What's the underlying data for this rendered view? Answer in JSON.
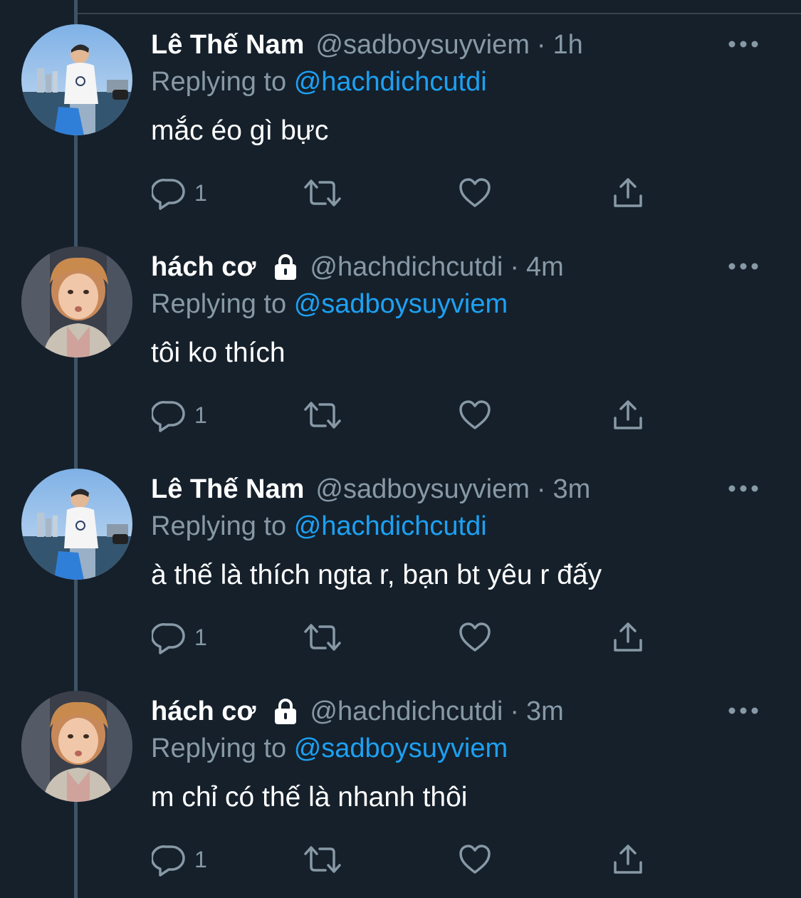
{
  "colors": {
    "background": "#15202b",
    "primary_text": "#ffffff",
    "secondary_text": "#8899a6",
    "link": "#1da1f2",
    "thread_line": "#3d5466"
  },
  "tweets": [
    {
      "display_name": "Lê Thế Nam",
      "handle": "@sadboysuyviem",
      "separator": "·",
      "time": "1h",
      "protected": false,
      "avatar": "user-lethenam-avatar",
      "replying_prefix": "Replying to",
      "replying_to": "@hachdichcutdi",
      "text": "mắc éo gì bực",
      "reply_count": "1"
    },
    {
      "display_name": "hách cơ",
      "handle": "@hachdichcutdi",
      "separator": "·",
      "time": "4m",
      "protected": true,
      "avatar": "user-hachco-avatar",
      "replying_prefix": "Replying to",
      "replying_to": "@sadboysuyviem",
      "text": "tôi ko thích",
      "reply_count": "1"
    },
    {
      "display_name": "Lê Thế Nam",
      "handle": "@sadboysuyviem",
      "separator": "·",
      "time": "3m",
      "protected": false,
      "avatar": "user-lethenam-avatar",
      "replying_prefix": "Replying to",
      "replying_to": "@hachdichcutdi",
      "text": "à thế là thích ngta r, bạn bt yêu r đấy",
      "reply_count": "1"
    },
    {
      "display_name": "hách cơ",
      "handle": "@hachdichcutdi",
      "separator": "·",
      "time": "3m",
      "protected": true,
      "avatar": "user-hachco-avatar",
      "replying_prefix": "Replying to",
      "replying_to": "@sadboysuyviem",
      "text": "m chỉ có thế là nhanh thôi",
      "reply_count": "1"
    }
  ],
  "icons": {
    "reply": "reply-icon",
    "retweet": "retweet-icon",
    "like": "heart-icon",
    "share": "share-icon",
    "more": "more-options-icon",
    "lock": "lock-icon"
  }
}
